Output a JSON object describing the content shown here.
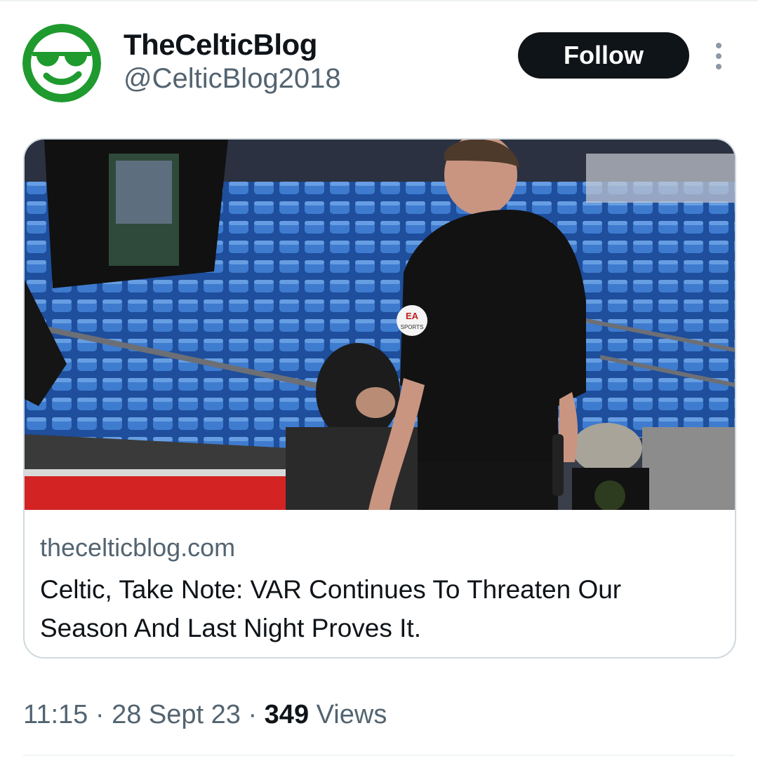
{
  "author": {
    "display_name": "TheCelticBlog",
    "handle": "@CelticBlog2018",
    "avatar_icon": "sunglasses-smiley-icon",
    "avatar_color": "#1f9a2e"
  },
  "actions": {
    "follow_label": "Follow",
    "more_icon": "more-dots-icon"
  },
  "link_card": {
    "image_alt": "Referee in black kit looking at a VAR pitchside monitor in front of blue stadium seats",
    "domain": "thecelticblog.com",
    "title": "Celtic, Take Note: VAR Continues To Threaten Our Season And Last Night Proves It.",
    "sleeve_badge": "EA SPORTS"
  },
  "meta": {
    "time": "11:15",
    "separator": "·",
    "date": "28 Sept 23",
    "views_count": "349",
    "views_label": "Views"
  },
  "colors": {
    "text_primary": "#0f1419",
    "text_secondary": "#536471",
    "follow_bg": "#0f1419",
    "border": "#cfd9de"
  }
}
